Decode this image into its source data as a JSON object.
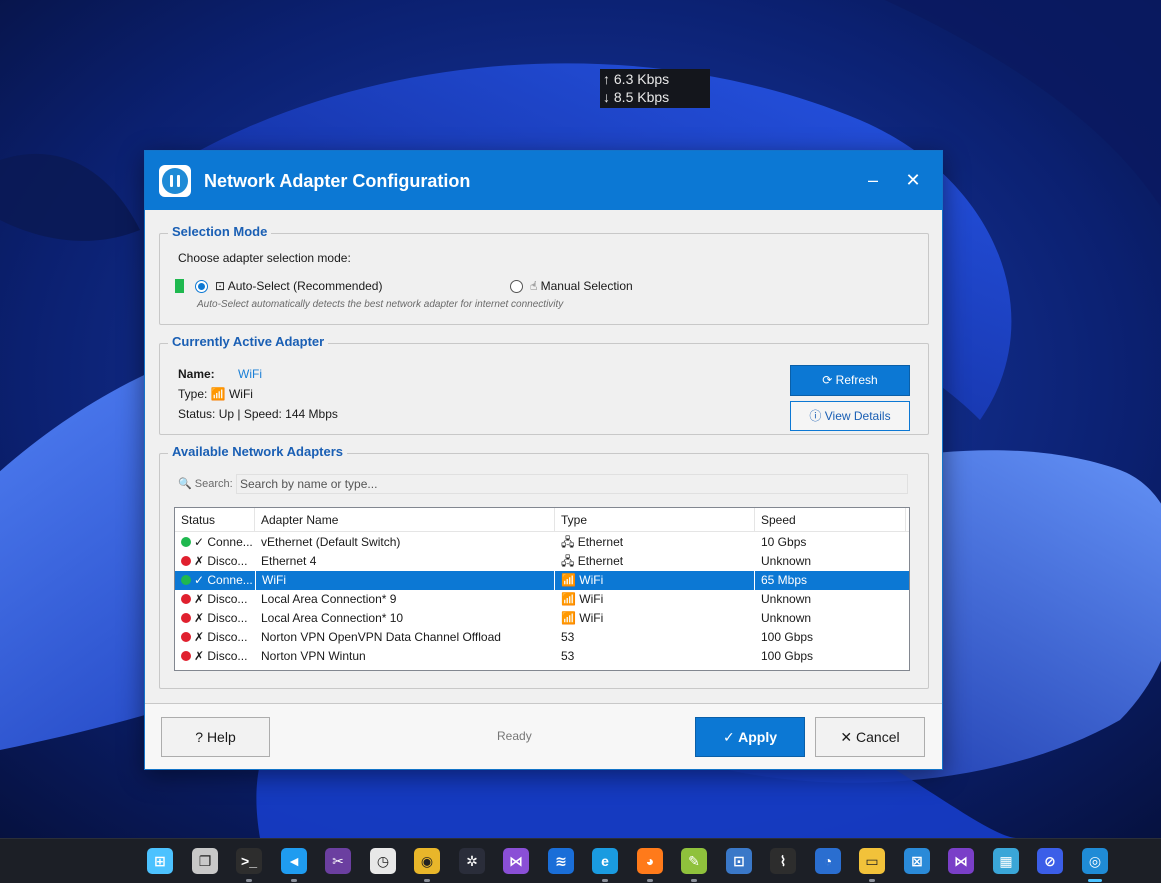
{
  "netspeed": {
    "up": "↑ 6.3 Kbps",
    "down": "↓ 8.5 Kbps"
  },
  "dialog": {
    "title": "Network Adapter Configuration",
    "minimize_glyph": "–",
    "close_glyph": "✕"
  },
  "selection_mode": {
    "title": "Selection Mode",
    "prompt": "Choose adapter selection mode:",
    "auto_label": "⊡ Auto-Select (Recommended)",
    "manual_label": "☝ Manual Selection",
    "hint": "Auto-Select automatically detects the best network adapter for internet connectivity",
    "selected": "auto"
  },
  "active_adapter": {
    "title": "Currently Active Adapter",
    "name_label": "Name:",
    "name_value": "WiFi",
    "type_line": "Type: 📶 WiFi",
    "status_line": "Status: Up | Speed: 144 Mbps",
    "refresh_label": "⟳ Refresh",
    "details_label": "ⓘ View Details"
  },
  "available": {
    "title": "Available Network Adapters",
    "search_label": "🔍 Search:",
    "search_placeholder": "Search by name or type...",
    "columns": [
      "Status",
      "Adapter Name",
      "Type",
      "Speed"
    ],
    "rows": [
      {
        "status": "✓ Conne...",
        "state": "green",
        "name": "vEthernet (Default Switch)",
        "type": "🖧 Ethernet",
        "speed": "10 Gbps"
      },
      {
        "status": "✗ Disco...",
        "state": "red",
        "name": "Ethernet 4",
        "type": "🖧 Ethernet",
        "speed": "Unknown"
      },
      {
        "status": "✓ Conne...",
        "state": "green",
        "name": "WiFi",
        "type": "📶 WiFi",
        "speed": "65 Mbps",
        "selected": true
      },
      {
        "status": "✗ Disco...",
        "state": "red",
        "name": "Local Area Connection* 9",
        "type": "📶 WiFi",
        "speed": "Unknown"
      },
      {
        "status": "✗ Disco...",
        "state": "red",
        "name": "Local Area Connection* 10",
        "type": "📶 WiFi",
        "speed": "Unknown"
      },
      {
        "status": "✗ Disco...",
        "state": "red",
        "name": "Norton VPN OpenVPN Data Channel Offload",
        "type": "53",
        "speed": "100 Gbps"
      },
      {
        "status": "✗ Disco...",
        "state": "red",
        "name": "Norton VPN Wintun",
        "type": "53",
        "speed": "100 Gbps"
      }
    ]
  },
  "footer": {
    "help_label": "?  Help",
    "status": "Ready",
    "apply_label": "✓ Apply",
    "cancel_label": "✕ Cancel"
  },
  "taskbar": {
    "icons": [
      {
        "name": "start-icon",
        "color": "#4cc2ff",
        "glyph": "⊞"
      },
      {
        "name": "task-view-icon",
        "color": "#c8c8c8",
        "glyph": "❐"
      },
      {
        "name": "terminal-icon",
        "color": "#2d2d2d",
        "glyph": ">_"
      },
      {
        "name": "vscode-icon",
        "color": "#1f9cf0",
        "glyph": "◄"
      },
      {
        "name": "snipping-tool-icon",
        "color": "#6b3fa0",
        "glyph": "✂"
      },
      {
        "name": "clock-app-icon",
        "color": "#e8e8e8",
        "glyph": "◷"
      },
      {
        "name": "chrome-icon",
        "color": "#e8b62a",
        "glyph": "◉"
      },
      {
        "name": "camera-app-icon",
        "color": "#2a2d3a",
        "glyph": "✲"
      },
      {
        "name": "visual-studio-icon",
        "color": "#8a4fd6",
        "glyph": "⋈"
      },
      {
        "name": "power-automate-icon",
        "color": "#1a6ed8",
        "glyph": "≋"
      },
      {
        "name": "edge-icon",
        "color": "#1a9be0",
        "glyph": "e"
      },
      {
        "name": "firefox-icon",
        "color": "#ff7a1a",
        "glyph": "◕"
      },
      {
        "name": "notepad-icon",
        "color": "#8fc13c",
        "glyph": "✎"
      },
      {
        "name": "remote-desktop-icon",
        "color": "#3a78c8",
        "glyph": "⊡"
      },
      {
        "name": "wifi-app-icon",
        "color": "#2d2d2d",
        "glyph": "⌇"
      },
      {
        "name": "speed-test-icon",
        "color": "#2a6ed0",
        "glyph": "◔"
      },
      {
        "name": "file-explorer-icon",
        "color": "#f2c23a",
        "glyph": "▭"
      },
      {
        "name": "store-icon",
        "color": "#2a8ad8",
        "glyph": "⊠"
      },
      {
        "name": "visual-studio-preview-icon",
        "color": "#7a3fc8",
        "glyph": "⋈"
      },
      {
        "name": "control-panel-icon",
        "color": "#3aa6d8",
        "glyph": "▦"
      },
      {
        "name": "link-app-icon",
        "color": "#3b5ee8",
        "glyph": "⊘"
      },
      {
        "name": "network-adapter-app-icon",
        "color": "#1f8bd6",
        "glyph": "◎"
      }
    ]
  },
  "colors": {
    "accent": "#0c78d4",
    "connected": "#1fb84f",
    "disconnected": "#e0202e",
    "group_title": "#1a5fb4"
  }
}
